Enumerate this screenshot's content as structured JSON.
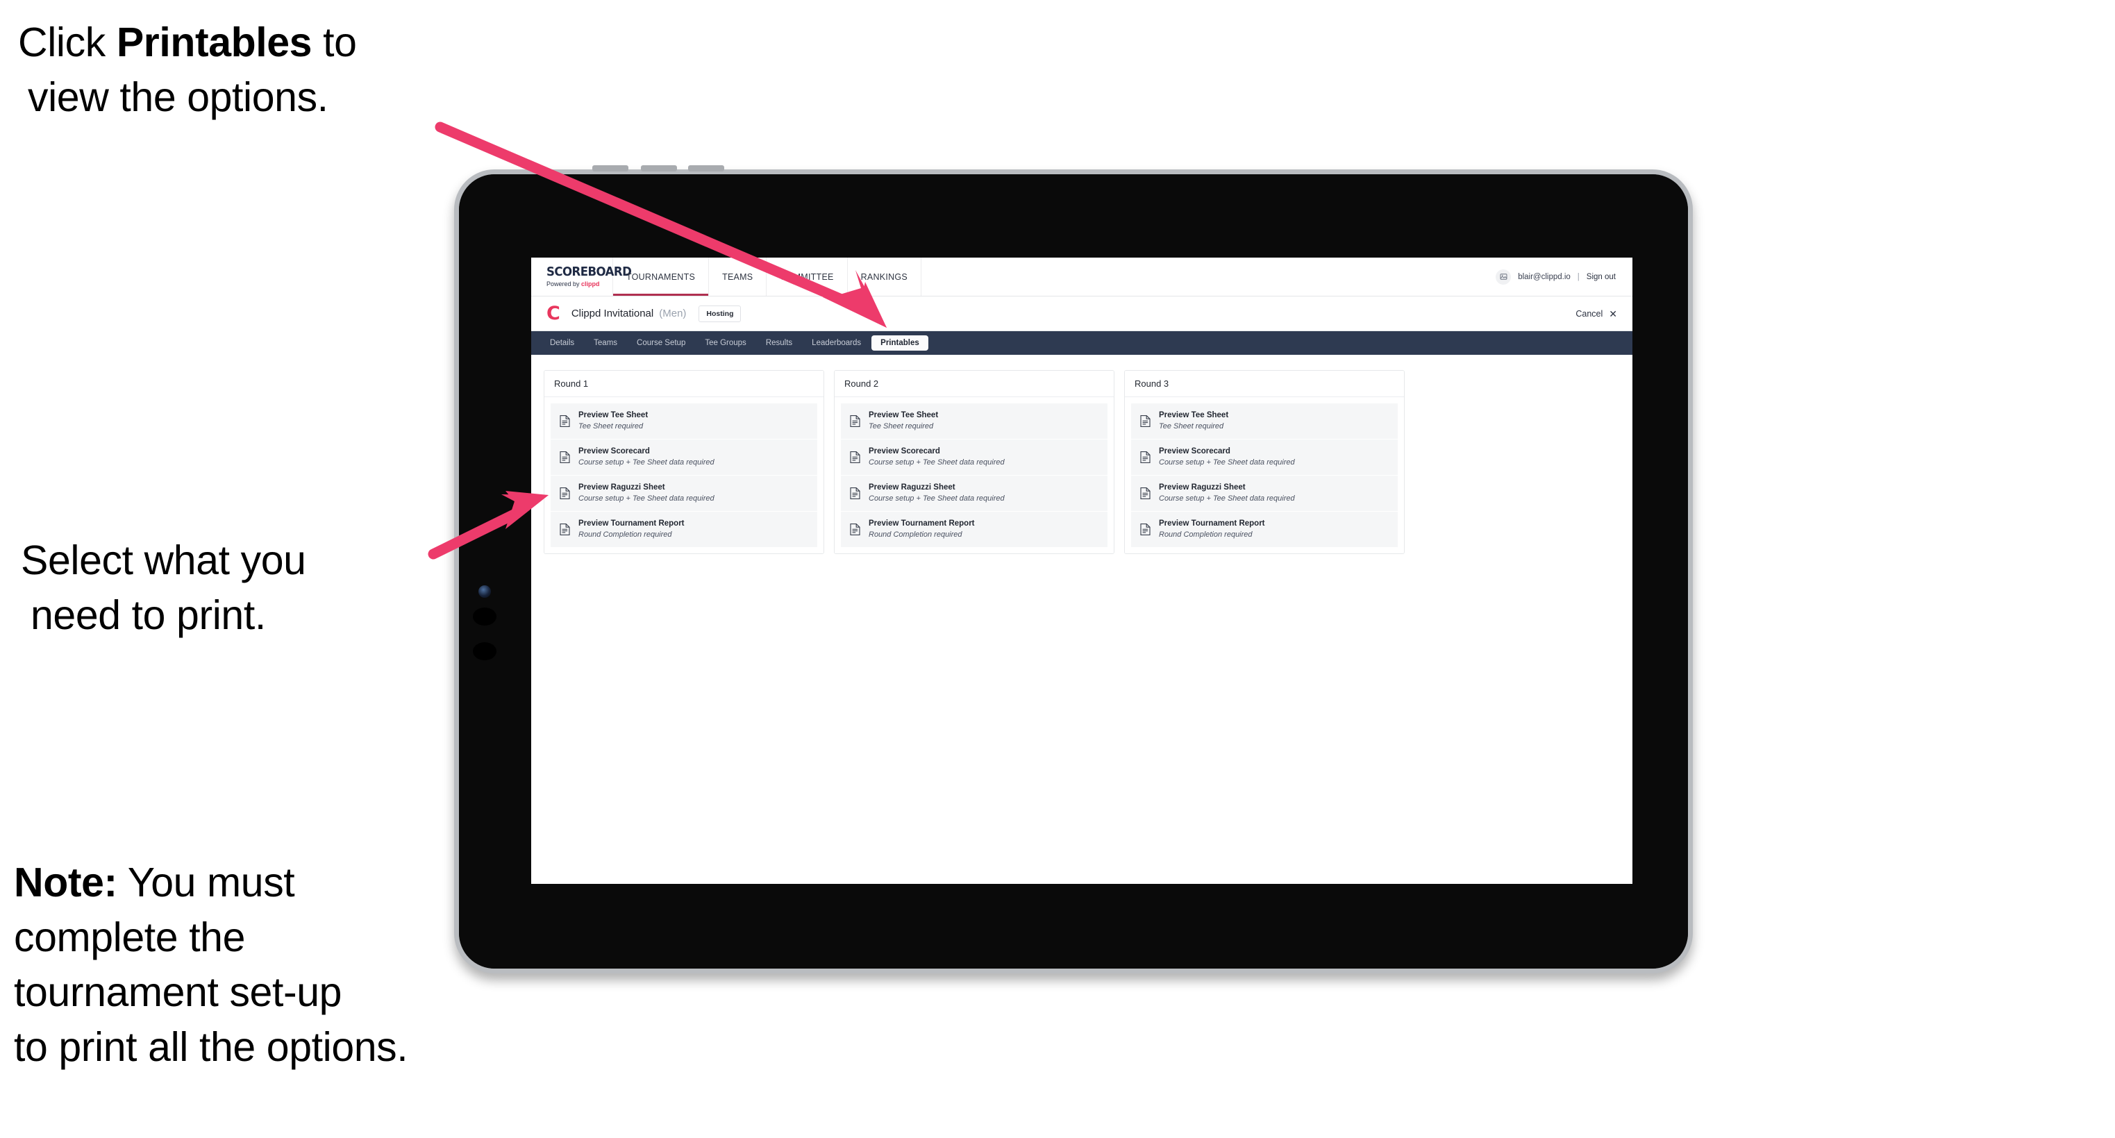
{
  "annotations": {
    "click_line1_pre": "Click ",
    "click_bold": "Printables",
    "click_line1_post": " to",
    "click_line2": "view the options.",
    "select_line1": "Select what you",
    "select_line2": "need to print.",
    "note_bold": "Note:",
    "note_line1_rest": " You must",
    "note_line2": "complete the",
    "note_line3": "tournament set-up",
    "note_line4": "to print all the options.",
    "arrow_color": "#ed3b6b"
  },
  "app": {
    "brand": {
      "title": "SCOREBOARD",
      "powered_prefix": "Powered by ",
      "powered_brand": "clippd"
    },
    "topnav": {
      "items": [
        {
          "label": "TOURNAMENTS",
          "active": true
        },
        {
          "label": "TEAMS",
          "active": false
        },
        {
          "label": "COMMITTEE",
          "active": false
        },
        {
          "label": "RANKINGS",
          "active": false
        }
      ],
      "user_email": "blair@clippd.io",
      "separator": "|",
      "sign_out": "Sign out",
      "avatar_icon": "user-image-icon"
    },
    "titlebar": {
      "logo_mark": "C",
      "tournament_name": "Clippd Invitational",
      "gender": "(Men)",
      "hosting_badge": "Hosting",
      "cancel_label": "Cancel",
      "cancel_icon": "✕"
    },
    "subtabs": [
      {
        "label": "Details",
        "active": false
      },
      {
        "label": "Teams",
        "active": false
      },
      {
        "label": "Course Setup",
        "active": false
      },
      {
        "label": "Tee Groups",
        "active": false
      },
      {
        "label": "Results",
        "active": false
      },
      {
        "label": "Leaderboards",
        "active": false
      },
      {
        "label": "Printables",
        "active": true
      }
    ],
    "rounds": [
      {
        "header": "Round 1",
        "items": [
          {
            "title": "Preview Tee Sheet",
            "requirement": "Tee Sheet required"
          },
          {
            "title": "Preview Scorecard",
            "requirement": "Course setup + Tee Sheet data required"
          },
          {
            "title": "Preview Raguzzi Sheet",
            "requirement": "Course setup + Tee Sheet data required"
          },
          {
            "title": "Preview Tournament Report",
            "requirement": "Round Completion required"
          }
        ]
      },
      {
        "header": "Round 2",
        "items": [
          {
            "title": "Preview Tee Sheet",
            "requirement": "Tee Sheet required"
          },
          {
            "title": "Preview Scorecard",
            "requirement": "Course setup + Tee Sheet data required"
          },
          {
            "title": "Preview Raguzzi Sheet",
            "requirement": "Course setup + Tee Sheet data required"
          },
          {
            "title": "Preview Tournament Report",
            "requirement": "Round Completion required"
          }
        ]
      },
      {
        "header": "Round 3",
        "items": [
          {
            "title": "Preview Tee Sheet",
            "requirement": "Tee Sheet required"
          },
          {
            "title": "Preview Scorecard",
            "requirement": "Course setup + Tee Sheet data required"
          },
          {
            "title": "Preview Raguzzi Sheet",
            "requirement": "Course setup + Tee Sheet data required"
          },
          {
            "title": "Preview Tournament Report",
            "requirement": "Round Completion required"
          }
        ]
      }
    ]
  }
}
